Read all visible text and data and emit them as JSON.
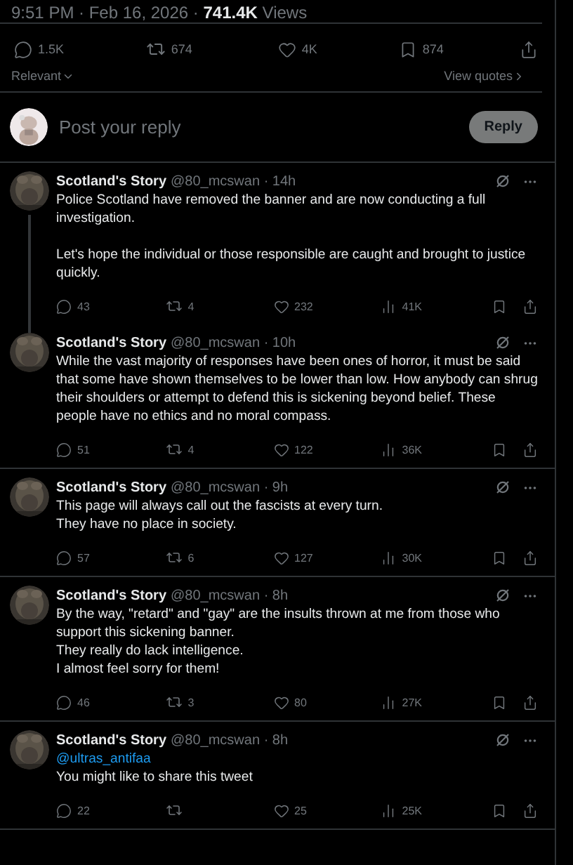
{
  "post_meta": {
    "time": "9:51 PM · Feb 16, 2026 · ",
    "views": "741.4K",
    "views_label": "Views"
  },
  "stats": {
    "replies": "1.5K",
    "reposts": "674",
    "likes": "4K",
    "bookmarks": "874"
  },
  "sort": {
    "label": "Relevant",
    "quotes": "View quotes"
  },
  "composer": {
    "placeholder": "Post your reply",
    "button": "Reply",
    "button_disabled": true
  },
  "replies": [
    {
      "name": "Scotland's Story",
      "handle": "@80_mcswan",
      "time": "· 14h",
      "connected": true,
      "paragraphs": [
        [
          {
            "kind": "text",
            "text": "Police Scotland have removed the banner and are now conducting a full investigation."
          }
        ],
        [
          {
            "kind": "text",
            "text": "Let's hope the individual or those responsible are caught and brought to justice quickly."
          }
        ]
      ],
      "replies_count": "43",
      "reposts": "4",
      "likes": "232",
      "views": "41K"
    },
    {
      "name": "Scotland's Story",
      "handle": "@80_mcswan",
      "time": "· 10h",
      "connected": false,
      "paragraphs": [
        [
          {
            "kind": "text",
            "text": "While the vast majority of responses have been ones of horror, it must be said that some have shown themselves to be lower than low. How anybody can shrug their shoulders or attempt to defend this is sickening beyond belief. These people have no ethics and no moral compass."
          }
        ]
      ],
      "replies_count": "51",
      "reposts": "4",
      "likes": "122",
      "views": "36K"
    },
    {
      "name": "Scotland's Story",
      "handle": "@80_mcswan",
      "time": "· 9h",
      "connected": false,
      "paragraphs": [
        [
          {
            "kind": "text",
            "text": "This page will always call out the fascists at every turn."
          },
          {
            "kind": "text",
            "text": "They have no place in society."
          }
        ]
      ],
      "replies_count": "57",
      "reposts": "6",
      "likes": "127",
      "views": "30K"
    },
    {
      "name": "Scotland's Story",
      "handle": "@80_mcswan",
      "time": "· 8h",
      "connected": false,
      "paragraphs": [
        [
          {
            "kind": "text",
            "text": "By the way, \"retard\" and \"gay\" are the insults thrown at me from those who support this sickening banner."
          },
          {
            "kind": "text",
            "text": "They really do lack intelligence."
          },
          {
            "kind": "text",
            "text": "I almost feel sorry for them!"
          }
        ]
      ],
      "replies_count": "46",
      "reposts": "3",
      "likes": "80",
      "views": "27K"
    },
    {
      "name": "Scotland's Story",
      "handle": "@80_mcswan",
      "time": "· 8h",
      "connected": false,
      "paragraphs": [
        [
          {
            "kind": "mention",
            "text": "@ultras_antifaa"
          },
          {
            "kind": "text",
            "text": "You might like to share this tweet"
          }
        ]
      ],
      "replies_count": "22",
      "likes": "25",
      "views": "25K"
    }
  ]
}
